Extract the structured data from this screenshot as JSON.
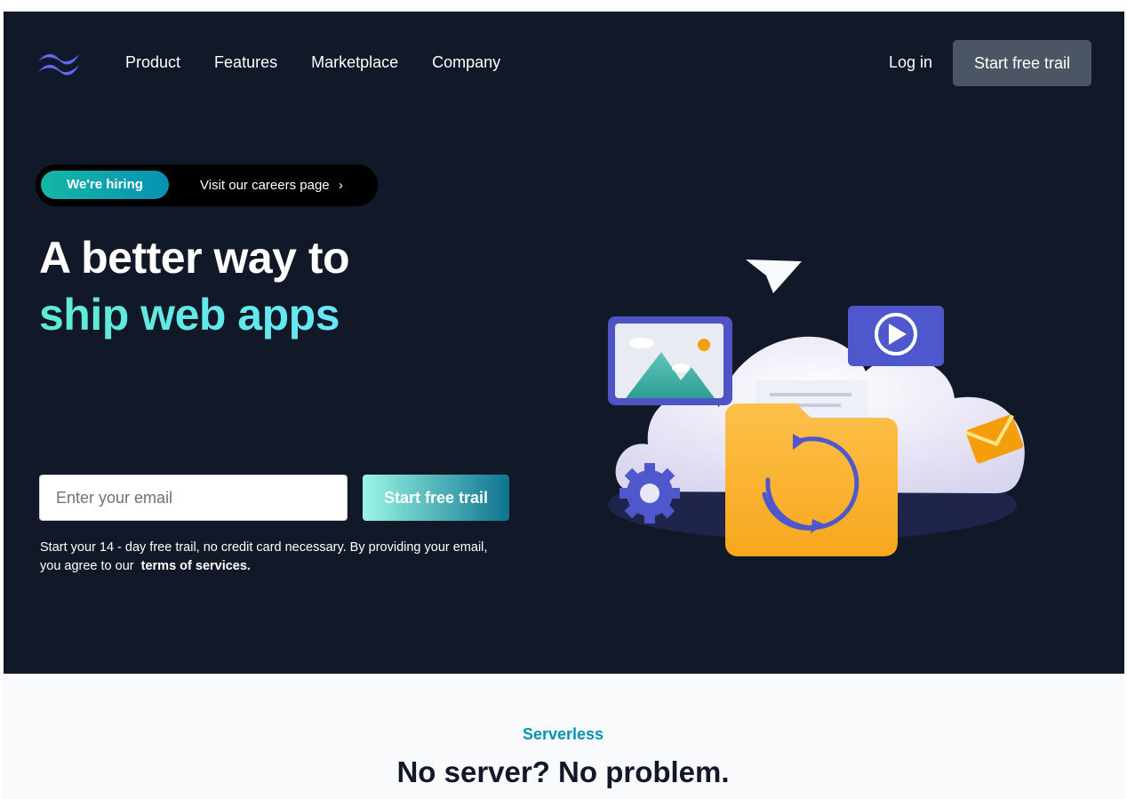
{
  "nav": {
    "links": [
      "Product",
      "Features",
      "Marketplace",
      "Company"
    ],
    "login": "Log in",
    "cta": "Start free trail"
  },
  "hero": {
    "badge": "We're hiring",
    "badge_link": "Visit our careers page",
    "headline_line1": "A better way to",
    "headline_line2": "ship web apps",
    "email_placeholder": "Enter your email",
    "cta": "Start free trail",
    "fine_print": "Start your 14 - day free trail, no credit card necessary. By providing your email, you agree to our",
    "terms_link": "terms of services."
  },
  "section": {
    "eyebrow": "Serverless",
    "title": "No server? No problem."
  },
  "colors": {
    "hero_bg": "#111827",
    "accent": "#5eead4",
    "nav_cta_bg": "#4b5563",
    "eyebrow": "#0891b2"
  }
}
